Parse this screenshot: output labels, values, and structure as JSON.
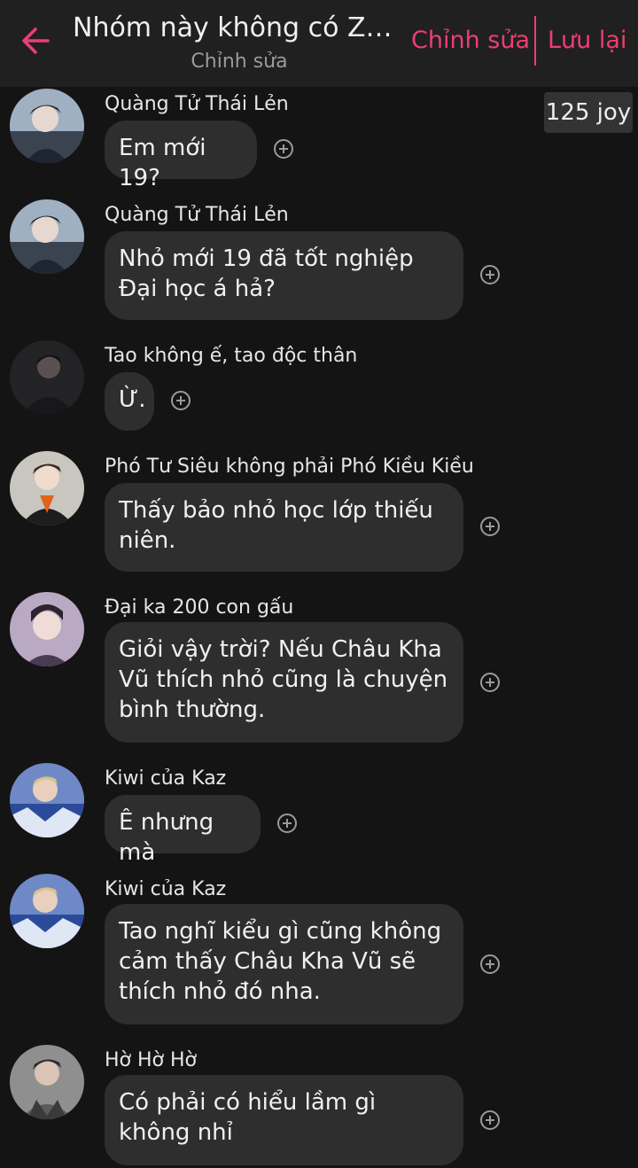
{
  "header": {
    "title": "Nhóm này không có ZKY...",
    "subtitle": "Chỉnh sửa",
    "edit_label": "Chỉnh sửa",
    "save_label": "Lưu lại",
    "back_icon": "arrow-left-icon"
  },
  "colors": {
    "accent": "#ee3d74",
    "bubble": "#2e2e2e",
    "background": "#141414"
  },
  "joy_badge": "125 joy",
  "messages": [
    {
      "sender": "Quàng Tử Thái Lẻn",
      "text": "Em mới 19?"
    },
    {
      "sender": "Quàng Tử Thái Lẻn",
      "text": "Nhỏ mới 19 đã tốt nghiệp Đại học á hả?"
    },
    {
      "sender": "Tao không ế, tao độc thân",
      "text": "Ừ."
    },
    {
      "sender": "Phó Tư Siêu không phải Phó Kiều Kiều",
      "text": "Thấy bảo nhỏ học lớp thiếu niên."
    },
    {
      "sender": "Đại ka 200 con gấu",
      "text": "Giỏi vậy trời? Nếu Châu Kha Vũ thích nhỏ cũng là chuyện bình thường."
    },
    {
      "sender": "Kiwi của Kaz",
      "text": "Ê nhưng mà"
    },
    {
      "sender": "Kiwi của Kaz",
      "text": "Tao nghĩ kiểu gì cũng không cảm thấy Châu Kha Vũ sẽ thích nhỏ đó nha."
    },
    {
      "sender": "Hờ Hờ Hờ",
      "text": "Có phải có hiểu lầm gì không nhỉ"
    }
  ]
}
